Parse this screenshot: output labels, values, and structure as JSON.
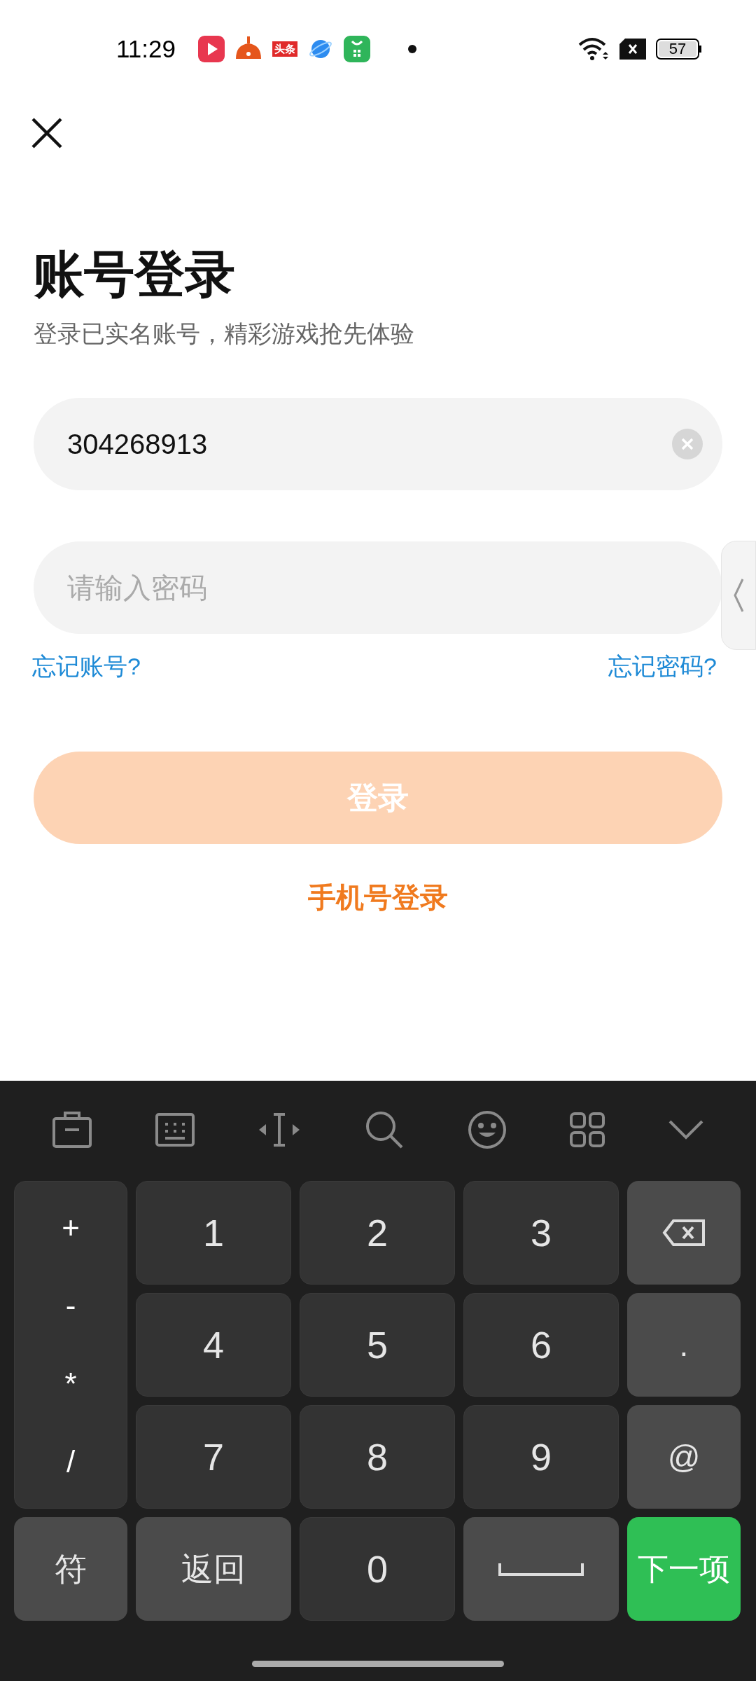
{
  "status_bar": {
    "time": "11:29",
    "news_app_label": "头条",
    "battery": "57"
  },
  "title": "账号登录",
  "subtitle": "登录已实名账号，精彩游戏抢先体验",
  "account_field": {
    "value": "304268913"
  },
  "password_field": {
    "placeholder": "请输入密码"
  },
  "links": [
    "忘记账号?",
    "忘记密码?"
  ],
  "login_button": {
    "label": "登录",
    "disabled": true
  },
  "phone_login": "手机号登录",
  "keyboard": {
    "symbols": [
      "+",
      "-",
      "*",
      "/"
    ],
    "rows": [
      [
        {
          "kind": "digit",
          "label": "1"
        },
        {
          "kind": "digit",
          "label": "2"
        },
        {
          "kind": "digit",
          "label": "3"
        },
        {
          "kind": "backspace"
        }
      ],
      [
        {
          "kind": "digit",
          "label": "4"
        },
        {
          "kind": "digit",
          "label": "5"
        },
        {
          "kind": "digit",
          "label": "6"
        },
        {
          "kind": "function",
          "label": "."
        }
      ],
      [
        {
          "kind": "digit",
          "label": "7"
        },
        {
          "kind": "digit",
          "label": "8"
        },
        {
          "kind": "digit",
          "label": "9"
        },
        {
          "kind": "function",
          "label": "@"
        }
      ]
    ],
    "bottom_row": [
      {
        "kind": "function",
        "label": "符"
      },
      {
        "kind": "function",
        "label": "返回"
      },
      {
        "kind": "digit",
        "label": "0"
      },
      {
        "kind": "space"
      },
      {
        "kind": "enter",
        "label": "下一项"
      }
    ]
  }
}
